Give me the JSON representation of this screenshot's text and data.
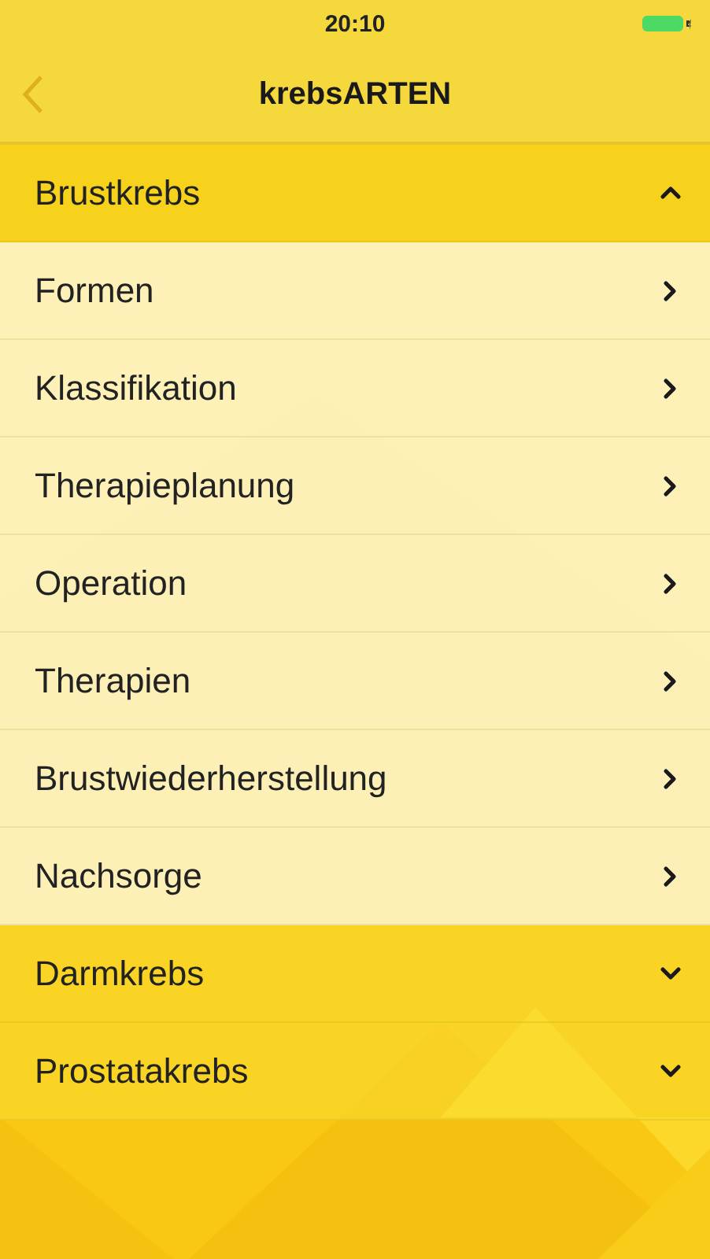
{
  "status_bar": {
    "time": "20:10"
  },
  "nav": {
    "title": "krebsARTEN"
  },
  "sections": [
    {
      "title": "Brustkrebs",
      "expanded": true,
      "items": [
        "Formen",
        "Klassifikation",
        "Therapieplanung",
        "Operation",
        "Therapien",
        "Brustwiederherstellung",
        "Nachsorge"
      ]
    },
    {
      "title": "Darmkrebs",
      "expanded": false
    },
    {
      "title": "Prostatakrebs",
      "expanded": false
    }
  ]
}
